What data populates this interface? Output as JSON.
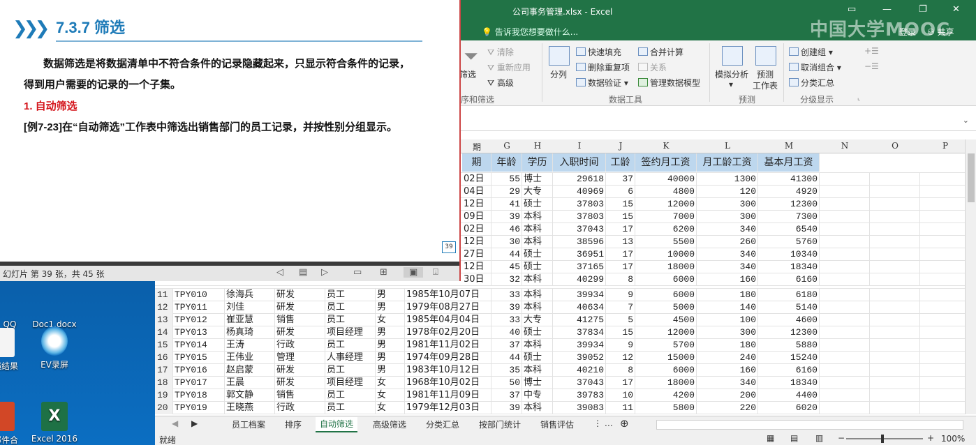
{
  "excel": {
    "title": "公司事务管理.xlsx - Excel",
    "tell_me": "告诉我您想要做什么...",
    "login": "登录",
    "share": "共享",
    "watermark": "中国大学MOOC",
    "ribbon": {
      "sort_filter": {
        "filter": "筛选",
        "clear": "清除",
        "reapply": "重新应用",
        "advanced": "高级",
        "group": "序和筛选"
      },
      "data_tools": {
        "split": "分列",
        "flash_fill": "快速填充",
        "remove_dup": "删除重复项",
        "validation": "数据验证",
        "consolidate": "合并计算",
        "relations": "关系",
        "data_model": "管理数据模型",
        "group": "数据工具"
      },
      "forecast": {
        "what_if": "模拟分析",
        "forecast_sheet": "预测\n工作表",
        "forecast_sheet_1": "预测",
        "forecast_sheet_2": "工作表",
        "group": "预测"
      },
      "outline": {
        "group_btn": "创建组",
        "ungroup": "取消组合",
        "subtotal": "分类汇总",
        "group": "分级显示"
      }
    },
    "columns": [
      "期",
      "G",
      "H",
      "I",
      "J",
      "K",
      "L",
      "M",
      "N",
      "O",
      "P"
    ],
    "header_row": [
      "期",
      "年龄",
      "学历",
      "入职时间",
      "工龄",
      "签约月工资",
      "月工龄工资",
      "基本月工资"
    ],
    "top_rows": [
      {
        "date": "02日",
        "age": "55",
        "edu": "博士",
        "hire": "29618",
        "years": "37",
        "salary": "40000",
        "yrs_pay": "1300",
        "base": "41300"
      },
      {
        "date": "04日",
        "age": "29",
        "edu": "大专",
        "hire": "40969",
        "years": "6",
        "salary": "4800",
        "yrs_pay": "120",
        "base": "4920"
      },
      {
        "date": "12日",
        "age": "41",
        "edu": "硕士",
        "hire": "37803",
        "years": "15",
        "salary": "12000",
        "yrs_pay": "300",
        "base": "12300"
      },
      {
        "date": "09日",
        "age": "39",
        "edu": "本科",
        "hire": "37803",
        "years": "15",
        "salary": "7000",
        "yrs_pay": "300",
        "base": "7300"
      },
      {
        "date": "02日",
        "age": "46",
        "edu": "本科",
        "hire": "37043",
        "years": "17",
        "salary": "6200",
        "yrs_pay": "340",
        "base": "6540"
      },
      {
        "date": "12日",
        "age": "30",
        "edu": "本科",
        "hire": "38596",
        "years": "13",
        "salary": "5500",
        "yrs_pay": "260",
        "base": "5760"
      },
      {
        "date": "27日",
        "age": "44",
        "edu": "硕士",
        "hire": "36951",
        "years": "17",
        "salary": "10000",
        "yrs_pay": "340",
        "base": "10340"
      },
      {
        "date": "12日",
        "age": "45",
        "edu": "硕士",
        "hire": "37165",
        "years": "17",
        "salary": "18000",
        "yrs_pay": "340",
        "base": "18340"
      },
      {
        "date": "30日",
        "age": "32",
        "edu": "本科",
        "hire": "40299",
        "years": "8",
        "salary": "6000",
        "yrs_pay": "160",
        "base": "6160"
      }
    ],
    "rows": [
      {
        "n": "11",
        "id": "TPY010",
        "name": "徐海兵",
        "dept": "研发",
        "pos": "员工",
        "sex": "男",
        "date": "1985年10月07日",
        "age": "33",
        "edu": "本科",
        "hire": "39934",
        "years": "9",
        "salary": "6000",
        "yrs_pay": "180",
        "base": "6180"
      },
      {
        "n": "12",
        "id": "TPY011",
        "name": "刘佳",
        "dept": "研发",
        "pos": "员工",
        "sex": "男",
        "date": "1979年08月27日",
        "age": "39",
        "edu": "本科",
        "hire": "40634",
        "years": "7",
        "salary": "5000",
        "yrs_pay": "140",
        "base": "5140"
      },
      {
        "n": "13",
        "id": "TPY012",
        "name": "崔亚慧",
        "dept": "销售",
        "pos": "员工",
        "sex": "女",
        "date": "1985年04月04日",
        "age": "33",
        "edu": "大专",
        "hire": "41275",
        "years": "5",
        "salary": "4500",
        "yrs_pay": "100",
        "base": "4600"
      },
      {
        "n": "14",
        "id": "TPY013",
        "name": "杨真琦",
        "dept": "研发",
        "pos": "项目经理",
        "sex": "男",
        "date": "1978年02月20日",
        "age": "40",
        "edu": "硕士",
        "hire": "37834",
        "years": "15",
        "salary": "12000",
        "yrs_pay": "300",
        "base": "12300"
      },
      {
        "n": "15",
        "id": "TPY014",
        "name": "王涛",
        "dept": "行政",
        "pos": "员工",
        "sex": "男",
        "date": "1981年11月02日",
        "age": "37",
        "edu": "本科",
        "hire": "39934",
        "years": "9",
        "salary": "5700",
        "yrs_pay": "180",
        "base": "5880"
      },
      {
        "n": "16",
        "id": "TPY015",
        "name": "王伟业",
        "dept": "管理",
        "pos": "人事经理",
        "sex": "男",
        "date": "1974年09月28日",
        "age": "44",
        "edu": "硕士",
        "hire": "39052",
        "years": "12",
        "salary": "15000",
        "yrs_pay": "240",
        "base": "15240"
      },
      {
        "n": "17",
        "id": "TPY016",
        "name": "赵启蒙",
        "dept": "研发",
        "pos": "员工",
        "sex": "男",
        "date": "1983年10月12日",
        "age": "35",
        "edu": "本科",
        "hire": "40210",
        "years": "8",
        "salary": "6000",
        "yrs_pay": "160",
        "base": "6160"
      },
      {
        "n": "18",
        "id": "TPY017",
        "name": "王晨",
        "dept": "研发",
        "pos": "项目经理",
        "sex": "女",
        "date": "1968年10月02日",
        "age": "50",
        "edu": "博士",
        "hire": "37043",
        "years": "17",
        "salary": "18000",
        "yrs_pay": "340",
        "base": "18340"
      },
      {
        "n": "19",
        "id": "TPY018",
        "name": "郭文静",
        "dept": "销售",
        "pos": "员工",
        "sex": "女",
        "date": "1981年11月09日",
        "age": "37",
        "edu": "中专",
        "hire": "39783",
        "years": "10",
        "salary": "4200",
        "yrs_pay": "200",
        "base": "4400"
      },
      {
        "n": "20",
        "id": "TPY019",
        "name": "王晓燕",
        "dept": "行政",
        "pos": "员工",
        "sex": "女",
        "date": "1979年12月03日",
        "age": "39",
        "edu": "本科",
        "hire": "39083",
        "years": "11",
        "salary": "5800",
        "yrs_pay": "220",
        "base": "6020"
      }
    ],
    "sheet_tabs": [
      "员工档案",
      "排序",
      "自动筛选",
      "高级筛选",
      "分类汇总",
      "按部门统计",
      "销售评估"
    ],
    "active_tab": "自动筛选",
    "status": "就绪",
    "zoom": "100%"
  },
  "desktop": {
    "icons": [
      "QQ",
      "Doc1.docx",
      "绩结果",
      "EV录屏",
      "邮件合",
      "Excel 2016"
    ]
  },
  "ppt": {
    "slide_title": "7.3.7  筛选",
    "para1": "数据筛选是将数据清单中不符合条件的记录隐藏起来，只显示符合条件的记录，",
    "para2": "得到用户需要的记录的一个子集。",
    "heading": "1. 自动筛选",
    "example": "[例7-23]在“自动筛选”工作表中筛选出销售部门的员工记录，并按性别分组显示。",
    "page_num": "39",
    "status": "幻灯片 第 39 张，共 45 张"
  }
}
